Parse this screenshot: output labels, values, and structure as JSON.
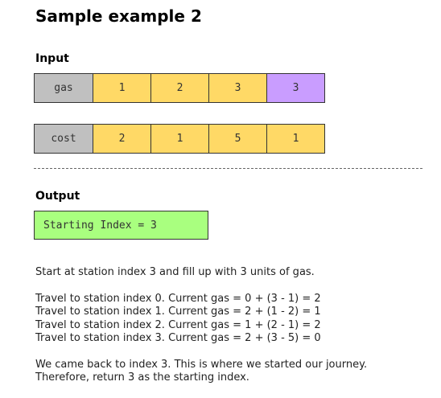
{
  "title": "Sample example 2",
  "input_label": "Input",
  "output_label": "Output",
  "arrays": {
    "gas": {
      "label": "gas",
      "values": [
        "1",
        "2",
        "3",
        "3"
      ]
    },
    "cost": {
      "label": "cost",
      "values": [
        "2",
        "1",
        "5",
        "1"
      ]
    }
  },
  "result": "Starting Index = 3",
  "explanation": {
    "intro": "Start at station index 3 and fill up with 3 units of gas.",
    "steps": [
      "Travel to station index 0. Current gas = 0 + (3 - 1) = 2",
      "Travel to station index 1. Current gas = 2 + (1 - 2) = 1",
      "Travel to station index 2. Current gas = 1 + (2 - 1) = 2",
      "Travel to station index 3. Current gas = 2 + (3 - 5) = 0"
    ],
    "conclusion": [
      "We came back to index 3. This is where we started our journey.",
      "Therefore, return 3 as the starting index."
    ]
  },
  "colors": {
    "header_cell": "#c0c0c0",
    "value_cell": "#ffd966",
    "highlight_cell": "#c99dff",
    "result_box": "#a9ff7f"
  }
}
